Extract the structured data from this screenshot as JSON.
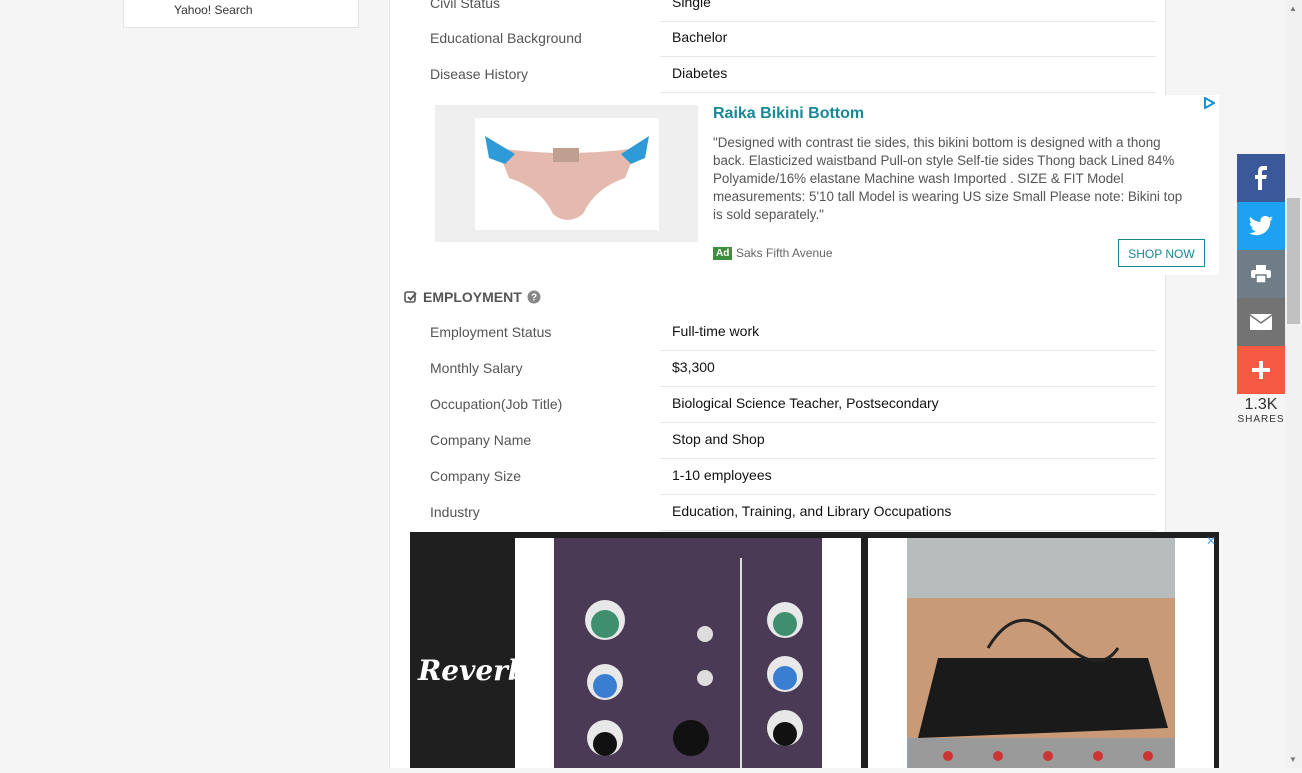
{
  "sidebar": {
    "link": "Yahoo! Search"
  },
  "personal_rows": [
    {
      "label": "Civil Status",
      "value": "Single"
    },
    {
      "label": "Educational Background",
      "value": "Bachelor"
    },
    {
      "label": "Disease History",
      "value": "Diabetes"
    }
  ],
  "ad_product": {
    "title": "Raika Bikini Bottom",
    "description": "\"Designed with contrast tie sides, this bikini bottom is designed with a thong back. Elasticized waistband Pull-on style Self-tie sides Thong back Lined 84% Polyamide/16% elastane Machine wash Imported . SIZE & FIT Model measurements: 5'10 tall Model is wearing US size Small Please note: Bikini top is sold separately.\"",
    "ad_badge": "Ad",
    "advertiser": "Saks Fifth Avenue",
    "cta": "SHOP NOW"
  },
  "employment": {
    "heading": "EMPLOYMENT",
    "rows": [
      {
        "label": "Employment Status",
        "value": "Full-time work"
      },
      {
        "label": "Monthly Salary",
        "value": "$3,300"
      },
      {
        "label": "Occupation(Job Title)",
        "value": "Biological Science Teacher, Postsecondary"
      },
      {
        "label": "Company Name",
        "value": "Stop and Shop"
      },
      {
        "label": "Company Size",
        "value": "1-10 employees"
      },
      {
        "label": "Industry",
        "value": "Education, Training, and Library Occupations"
      }
    ]
  },
  "ad_banner": {
    "brand": "Reverb",
    "close": "✕"
  },
  "share": {
    "count": "1.3K",
    "label": "SHARES",
    "colors": {
      "facebook": "#3b5998",
      "twitter": "#1da1f2",
      "print": "#6f7d86",
      "email": "#737373",
      "more": "#f65a42"
    }
  }
}
